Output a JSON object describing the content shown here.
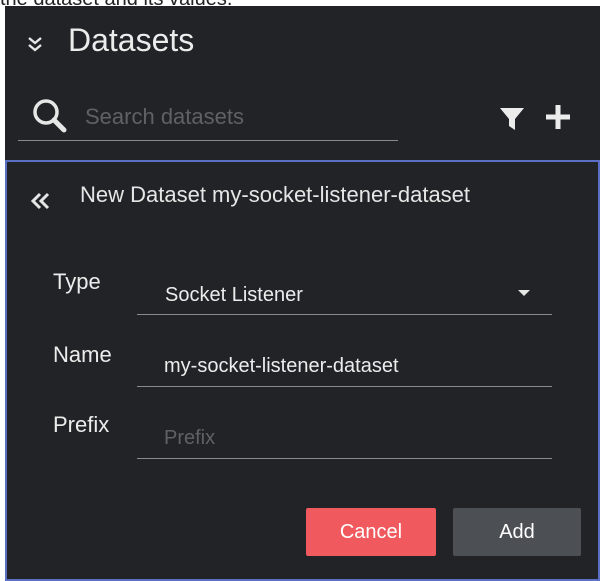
{
  "caption": "the dataset and its values.",
  "panel": {
    "title": "Datasets",
    "search": {
      "placeholder": "Search datasets",
      "value": ""
    }
  },
  "form": {
    "header": "New Dataset my-socket-listener-dataset",
    "type": {
      "label": "Type",
      "value": "Socket Listener"
    },
    "name": {
      "label": "Name",
      "value": "my-socket-listener-dataset"
    },
    "prefix": {
      "label": "Prefix",
      "placeholder": "Prefix",
      "value": ""
    },
    "cancel_label": "Cancel",
    "add_label": "Add"
  },
  "colors": {
    "panel_bg": "#222326",
    "form_border": "#5b6fc4",
    "cancel_bg": "#f05a5e",
    "add_bg": "#4c4f54"
  },
  "icons": [
    "double-chevron-down-icon",
    "search-icon",
    "filter-icon",
    "plus-icon",
    "double-chevron-left-icon",
    "caret-down-icon"
  ]
}
